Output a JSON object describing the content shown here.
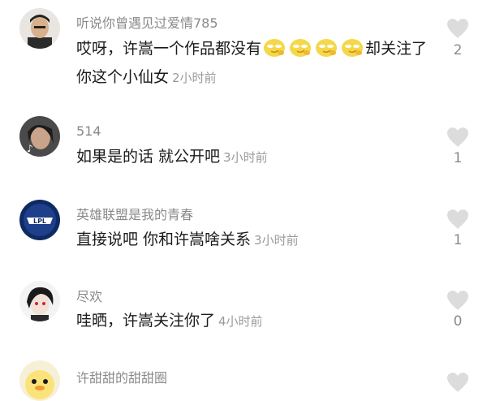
{
  "comments": [
    {
      "username": "听说你曾遇见过爱情785",
      "text_before": "哎呀，许嵩一个作品都没有",
      "emojis": [
        "smirk-chick-emoji",
        "smirk-chick-emoji",
        "smirk-chick-emoji",
        "smirk-chick-emoji"
      ],
      "text_after": "却关注了你这个小仙女",
      "time": "2小时前",
      "likes": "2"
    },
    {
      "username": "514",
      "text": "如果是的话 就公开吧",
      "time": "3小时前",
      "likes": "1"
    },
    {
      "username": "英雄联盟是我的青春",
      "avatar_logo_text": "LPL",
      "text": "直接说吧 你和许嵩啥关系",
      "time": "3小时前",
      "likes": "1"
    },
    {
      "username": "尽欢",
      "text": "哇晒，许嵩关注你了",
      "time": "4小时前",
      "likes": "0"
    },
    {
      "username": "许甜甜的甜甜圈"
    }
  ],
  "colors": {
    "username": "#8a8a8a",
    "text": "#1a1a1a",
    "time": "#9a9a9a",
    "heart": "#dcdcdc"
  }
}
